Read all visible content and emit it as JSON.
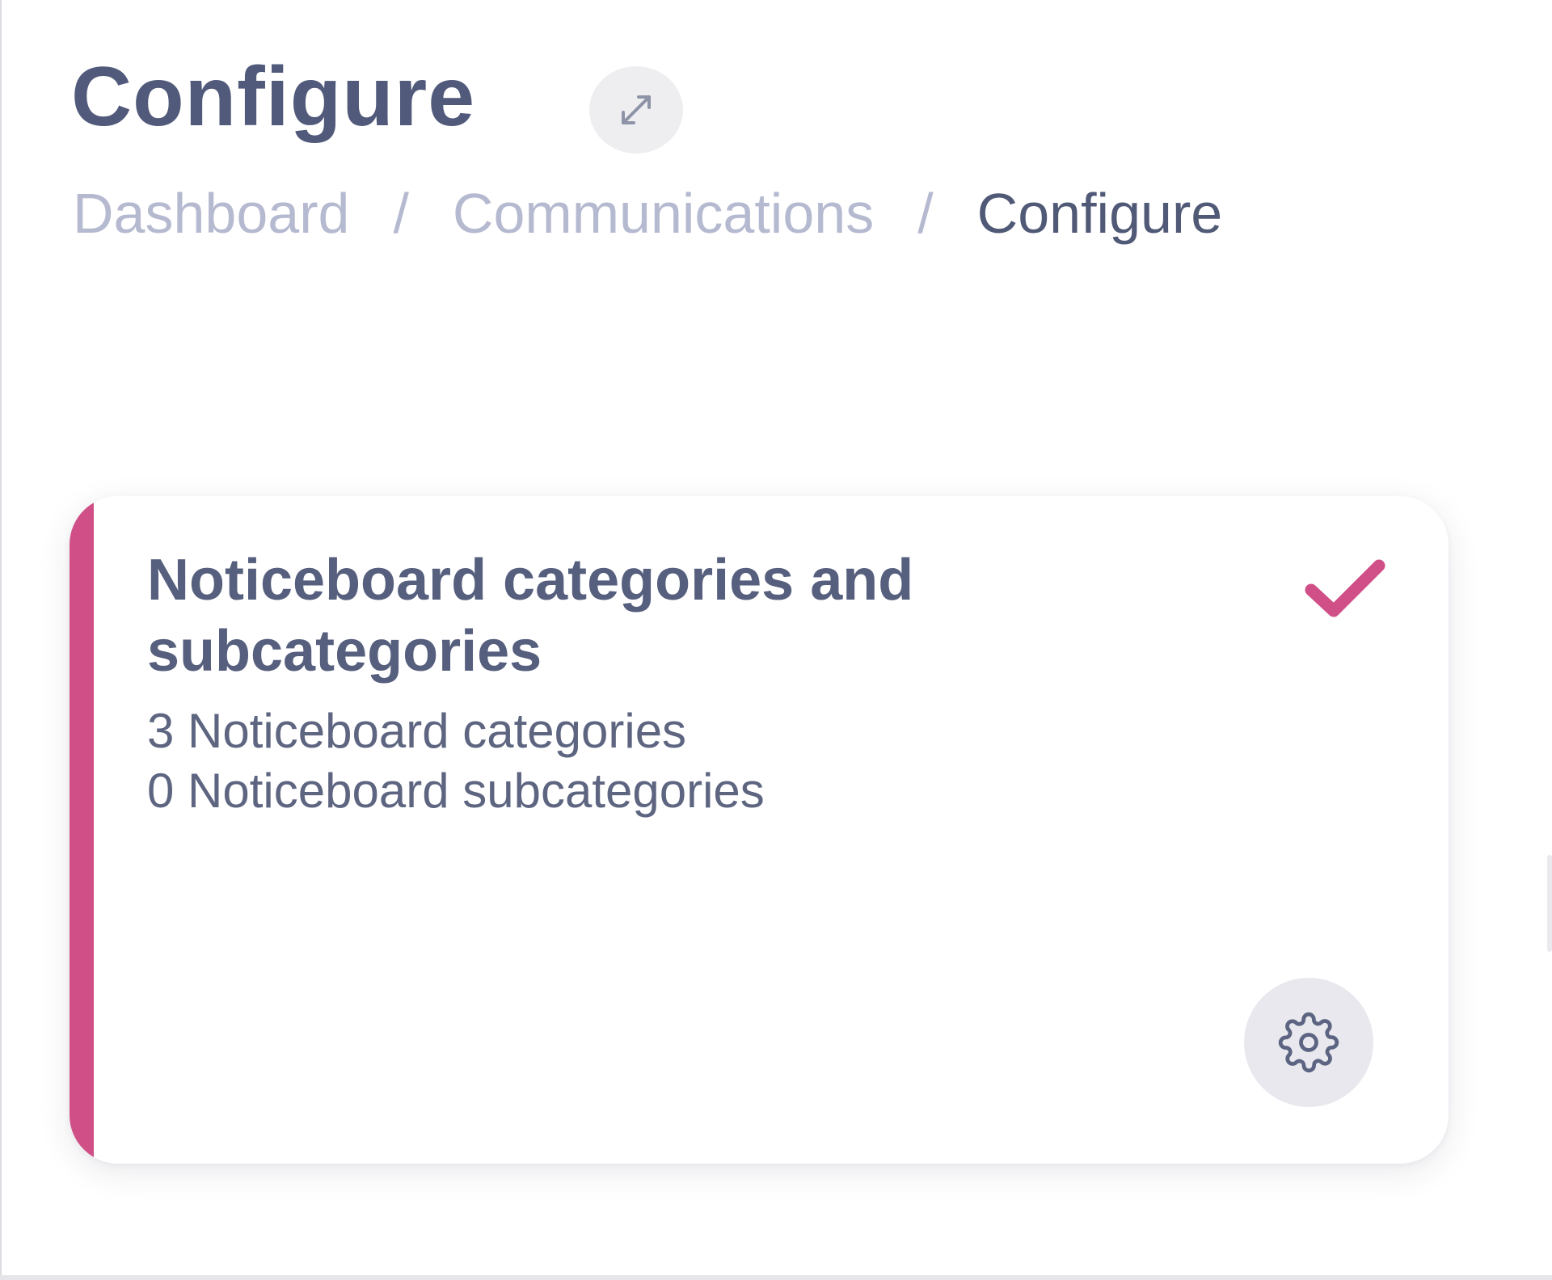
{
  "header": {
    "title": "Configure"
  },
  "breadcrumb": {
    "items": [
      "Dashboard",
      "Communications"
    ],
    "separator": "/",
    "current": "Configure"
  },
  "card": {
    "title": "Noticeboard categories and subcategories",
    "stats": [
      "3 Noticeboard categories",
      "0 Noticeboard subcategories"
    ],
    "status_icon": "check-icon",
    "action_icon": "gear-icon",
    "accent_color": "#d04f87"
  },
  "icons": {
    "expand": "expand-arrows-icon",
    "settings": "gear-icon"
  },
  "colors": {
    "heading": "#515a7a",
    "breadcrumb_link": "#b6bad0",
    "accent": "#d04f87"
  }
}
